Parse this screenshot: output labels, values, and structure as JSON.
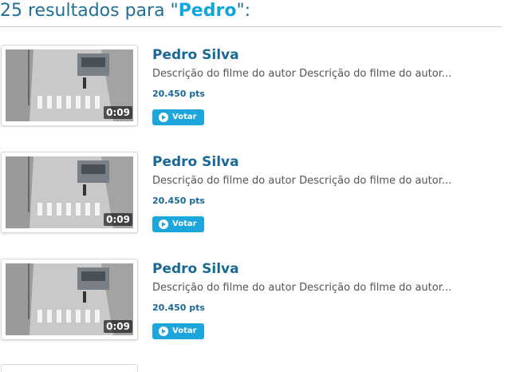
{
  "search": {
    "count": "25",
    "prefix_text": " resultados para \"",
    "query": "Pedro",
    "suffix_text": "\":"
  },
  "results": [
    {
      "title": "Pedro Silva",
      "description": "Descrição do filme do autor Descrição do filme do autor...",
      "points": "20.450 pts",
      "duration": "0:09",
      "vote_label": "Votar"
    },
    {
      "title": "Pedro Silva",
      "description": "Descrição do filme do autor Descrição do filme do autor...",
      "points": "20.450 pts",
      "duration": "0:09",
      "vote_label": "Votar"
    },
    {
      "title": "Pedro Silva",
      "description": "Descrição do filme do autor Descrição do filme do autor...",
      "points": "20.450 pts",
      "duration": "0:09",
      "vote_label": "Votar"
    }
  ],
  "colors": {
    "header_text": "#1f6f96",
    "query_highlight": "#0fa6dc",
    "title": "#1a6896",
    "vote_button": "#1da6db"
  },
  "icons": {
    "vote_button": "play-icon"
  }
}
